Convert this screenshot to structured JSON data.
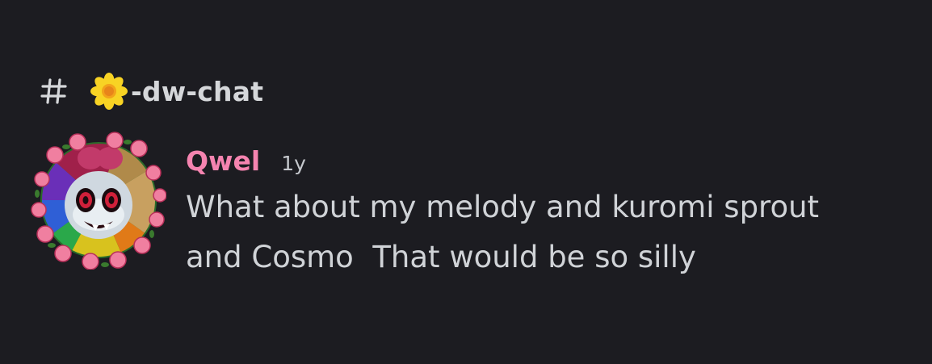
{
  "channel": {
    "name": "-dw-chat",
    "hash_icon": "hash-icon",
    "emoji_icon": "sunflower-icon"
  },
  "message": {
    "author": "Qwel",
    "timestamp": "1y",
    "lines": [
      "What about my melody and kuromi sprout",
      "and Cosmo  That would be so silly"
    ],
    "avatar_icon": "flower-clown-avatar"
  },
  "colors": {
    "background": "#1c1c21",
    "author": "#f584b0",
    "text": "#d0d3d7"
  }
}
